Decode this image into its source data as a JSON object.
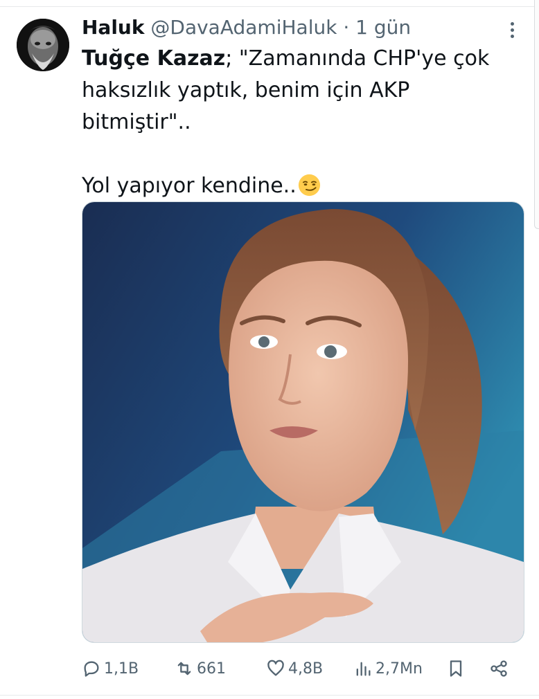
{
  "tweet": {
    "author_name": "Haluk",
    "author_handle": "@DavaAdamiHaluk",
    "separator": "·",
    "time": "1 gün",
    "quoted_person": "Tuğçe Kazaz",
    "line1_rest": "; \"Zamanında CHP'ye çok",
    "line2": "haksızlık yaptık, benim için AKP",
    "line3": "bitmiştir\"..",
    "line4": "Yol yapıyor kendine..",
    "emoji": "smirking-face-emoji"
  },
  "actions": {
    "replies": "1,1B",
    "retweets": "661",
    "likes": "4,8B",
    "views": "2,7Mn"
  },
  "colors": {
    "text": "#0f1419",
    "secondary": "#536471",
    "divider": "#e7e9eb"
  }
}
